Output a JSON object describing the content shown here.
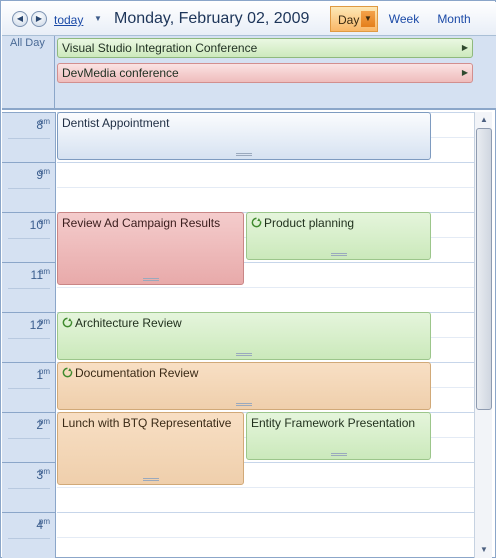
{
  "toolbar": {
    "today_label": "today",
    "date_title": "Monday, February 02, 2009",
    "views": {
      "day": "Day",
      "week": "Week",
      "month": "Month"
    },
    "active_view": "Day"
  },
  "all_day": {
    "label": "All Day",
    "events": [
      {
        "title": "Visual Studio Integration Conference",
        "color": "#cde9bd"
      },
      {
        "title": "DevMedia conference",
        "color": "#efbcbc"
      }
    ]
  },
  "hours": [
    {
      "num": "8",
      "ampm": "am"
    },
    {
      "num": "9",
      "ampm": "am"
    },
    {
      "num": "10",
      "ampm": "am"
    },
    {
      "num": "11",
      "ampm": "am"
    },
    {
      "num": "12",
      "ampm": "pm"
    },
    {
      "num": "1",
      "ampm": "pm"
    },
    {
      "num": "2",
      "ampm": "pm"
    },
    {
      "num": "3",
      "ampm": "pm"
    },
    {
      "num": "4",
      "ampm": "pm"
    }
  ],
  "events": {
    "dentist": {
      "title": "Dentist Appointment",
      "color": "#d6e2f1",
      "recurring": false
    },
    "review_ad": {
      "title": "Review Ad Campaign Results",
      "color": "#e8aaaa",
      "recurring": false
    },
    "product_planning": {
      "title": "Product planning",
      "color": "#cbe9bb",
      "recurring": true
    },
    "architecture": {
      "title": "Architecture Review",
      "color": "#cbe9bb",
      "recurring": true
    },
    "documentation": {
      "title": "Documentation Review",
      "color": "#efcfac",
      "recurring": true
    },
    "lunch": {
      "title": "Lunch with BTQ Representative",
      "color": "#efcfac",
      "recurring": false
    },
    "ef_presentation": {
      "title": "Entity Framework Presentation",
      "color": "#cbe9bb",
      "recurring": false
    }
  }
}
